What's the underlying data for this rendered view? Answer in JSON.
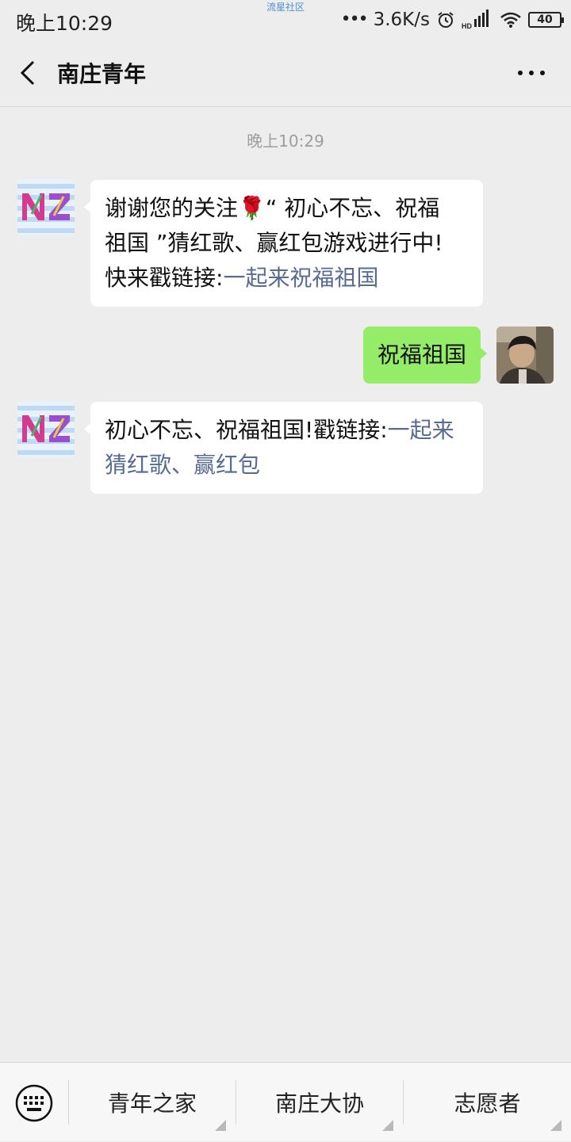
{
  "status_bar": {
    "time": "晚上10:29",
    "watermark": "流星社区",
    "net_speed": "3.6K/s",
    "battery": "40",
    "icons": [
      "alarm-icon",
      "hd-signal-icon",
      "wifi-icon",
      "battery-icon"
    ]
  },
  "nav": {
    "title": "南庄青年",
    "back_icon": "chevron-left-icon",
    "more_icon": "more-dots-icon"
  },
  "chat": {
    "timestamp": "晚上10:29",
    "messages": [
      {
        "from": "official",
        "text_line1": "谢谢您的关注",
        "emoji": "🌹",
        "text_rest1": "“ 初心不忘、祝福",
        "text_line2": "祖国 ”猜红歌、赢红包游戏进行中!",
        "text_line3_prefix": "快来戳链接:",
        "link": "一起来祝福祖国"
      },
      {
        "from": "me",
        "text": "祝福祖国"
      },
      {
        "from": "official",
        "text_prefix": "初心不忘、祝福祖国!戳链接:",
        "link": "一起来猜红歌、赢红包"
      }
    ]
  },
  "bottom_menu": {
    "keyboard_icon": "keyboard-icon",
    "items": [
      {
        "label": "青年之家"
      },
      {
        "label": "南庄大协"
      },
      {
        "label": "志愿者"
      }
    ]
  },
  "colors": {
    "background": "#ededed",
    "my_bubble": "#95ec69",
    "their_bubble": "#ffffff",
    "link": "#576b95"
  }
}
